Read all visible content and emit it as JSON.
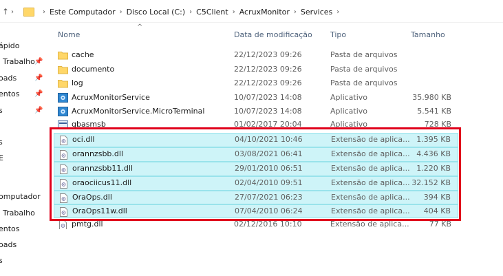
{
  "breadcrumb": {
    "items": [
      "Este Computador",
      "Disco Local (C:)",
      "C5Client",
      "AcruxMonitor",
      "Services"
    ]
  },
  "columns": {
    "name": "Nome",
    "date": "Data de modificação",
    "type": "Tipo",
    "size": "Tamanho"
  },
  "sidebar": {
    "items": [
      {
        "label": "ápido",
        "pinned": false
      },
      {
        "label": "Trabalho",
        "pinned": true
      },
      {
        "label": "oads",
        "pinned": true
      },
      {
        "label": "entos",
        "pinned": true
      },
      {
        "label": "s",
        "pinned": true
      },
      {
        "label": "s",
        "pinned": false
      },
      {
        "label": "E",
        "pinned": false
      },
      {
        "label": "omputador",
        "pinned": false
      },
      {
        "label": "Trabalho",
        "pinned": false
      },
      {
        "label": "entos",
        "pinned": false
      },
      {
        "label": "oads",
        "pinned": false
      },
      {
        "label": "s",
        "pinned": false
      }
    ]
  },
  "files": [
    {
      "name": "cache",
      "date": "22/12/2023 09:26",
      "type": "Pasta de arquivos",
      "size": "",
      "icon": "folder-icon"
    },
    {
      "name": "documento",
      "date": "22/12/2023 09:26",
      "type": "Pasta de arquivos",
      "size": "",
      "icon": "folder-icon"
    },
    {
      "name": "log",
      "date": "22/12/2023 09:26",
      "type": "Pasta de arquivos",
      "size": "",
      "icon": "folder-icon"
    },
    {
      "name": "AcruxMonitorService",
      "date": "10/07/2023 14:08",
      "type": "Aplicativo",
      "size": "35.980 KB",
      "icon": "app-icon"
    },
    {
      "name": "AcruxMonitorService.MicroTerminal",
      "date": "10/07/2023 14:08",
      "type": "Aplicativo",
      "size": "5.541 KB",
      "icon": "app-icon"
    },
    {
      "name": "gbasmsb",
      "date": "01/02/2017 20:04",
      "type": "Aplicativo",
      "size": "728 KB",
      "icon": "app-icon"
    },
    {
      "name": "oci.dll",
      "date": "04/10/2021 10:46",
      "type": "Extensão de aplica...",
      "size": "1.395 KB",
      "icon": "dll-icon"
    },
    {
      "name": "orannzsbb.dll",
      "date": "03/08/2021 06:41",
      "type": "Extensão de aplica...",
      "size": "4.436 KB",
      "icon": "dll-icon"
    },
    {
      "name": "orannzsbb11.dll",
      "date": "29/01/2010 06:51",
      "type": "Extensão de aplica...",
      "size": "1.220 KB",
      "icon": "dll-icon"
    },
    {
      "name": "oraociicus11.dll",
      "date": "02/04/2010 09:51",
      "type": "Extensão de aplica...",
      "size": "32.152 KB",
      "icon": "dll-icon"
    },
    {
      "name": "OraOps.dll",
      "date": "27/07/2021 06:23",
      "type": "Extensão de aplica...",
      "size": "394 KB",
      "icon": "dll-icon"
    },
    {
      "name": "OraOps11w.dll",
      "date": "07/04/2010 06:24",
      "type": "Extensão de aplica...",
      "size": "404 KB",
      "icon": "dll-icon"
    },
    {
      "name": "pmtg.dll",
      "date": "02/12/2016 10:10",
      "type": "Extensão de aplica...",
      "size": "77 KB",
      "icon": "dll-icon"
    }
  ],
  "colors": {
    "selection_bg": "#cef4f8",
    "selection_border": "#99e3eb",
    "highlight_box": "#e0001b",
    "column_header": "#4c607a"
  }
}
